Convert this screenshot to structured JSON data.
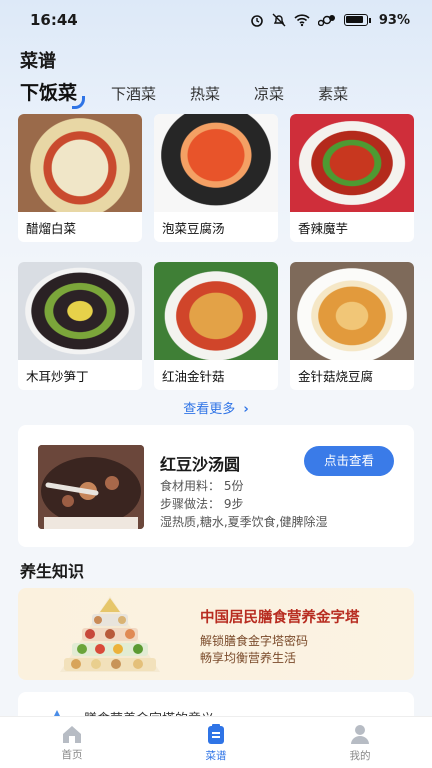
{
  "status": {
    "time": "16:44",
    "battery": "93%"
  },
  "page_title": "菜谱",
  "tabs": [
    {
      "label": "下饭菜",
      "active": true
    },
    {
      "label": "下酒菜"
    },
    {
      "label": "热菜"
    },
    {
      "label": "凉菜"
    },
    {
      "label": "素菜"
    }
  ],
  "recipes": [
    {
      "name": "醋熘白菜"
    },
    {
      "name": "泡菜豆腐汤"
    },
    {
      "name": "香辣魔芋"
    },
    {
      "name": "木耳炒笋丁"
    },
    {
      "name": "红油金针菇"
    },
    {
      "name": "金针菇烧豆腐"
    }
  ],
  "more": {
    "label": "查看更多"
  },
  "featured": {
    "title": "红豆沙汤圆",
    "button": "点击查看",
    "ingredients": "食材用料：  5份",
    "steps": "步骤做法：  9步",
    "tags": "湿热质,糖水,夏季饮食,健脾除湿"
  },
  "knowledge_section": {
    "title": "养生知识"
  },
  "knowledge_card": {
    "title": "中国居民膳食营养金字塔",
    "line1": "解锁膳食金字塔密码",
    "line2": "畅享均衡营养生活"
  },
  "next_card": {
    "title": "膳食营养金字塔的意义"
  },
  "tabbar": [
    {
      "label": "首页",
      "icon": "home-icon"
    },
    {
      "label": "菜谱",
      "icon": "recipe-icon",
      "active": true
    },
    {
      "label": "我的",
      "icon": "user-icon"
    }
  ],
  "colors": {
    "accent": "#2f74e6",
    "knowledge_title": "#b82d21"
  }
}
